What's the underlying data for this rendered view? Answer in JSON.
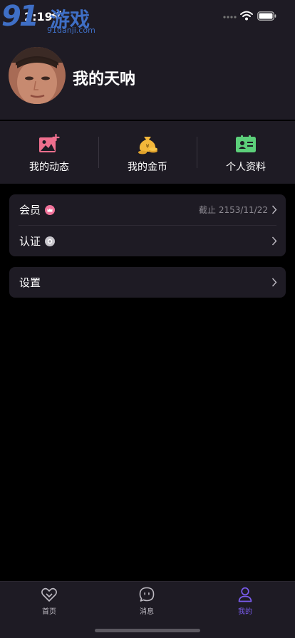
{
  "status_bar": {
    "time": "2:19"
  },
  "watermark": {
    "brand_number": "91",
    "brand_text": "游戏",
    "url": "91danji.com"
  },
  "profile": {
    "username": "我的天呐"
  },
  "quick_actions": [
    {
      "label": "我的动态",
      "icon": "image-add-icon",
      "color": "#ef6f8e"
    },
    {
      "label": "我的金币",
      "icon": "coin-bag-icon",
      "color": "#f3b73a"
    },
    {
      "label": "个人资料",
      "icon": "id-card-icon",
      "color": "#5ccf7a"
    }
  ],
  "membership_card": {
    "vip": {
      "label": "会员",
      "value": "截止 2153/11/22"
    },
    "verify": {
      "label": "认证"
    }
  },
  "settings": {
    "label": "设置"
  },
  "tabbar": {
    "items": [
      {
        "label": "首页",
        "icon": "heart-home-icon",
        "active": false
      },
      {
        "label": "消息",
        "icon": "chat-bubble-icon",
        "active": false
      },
      {
        "label": "我的",
        "icon": "person-icon",
        "active": true
      }
    ],
    "active_color": "#7b5cf0"
  }
}
